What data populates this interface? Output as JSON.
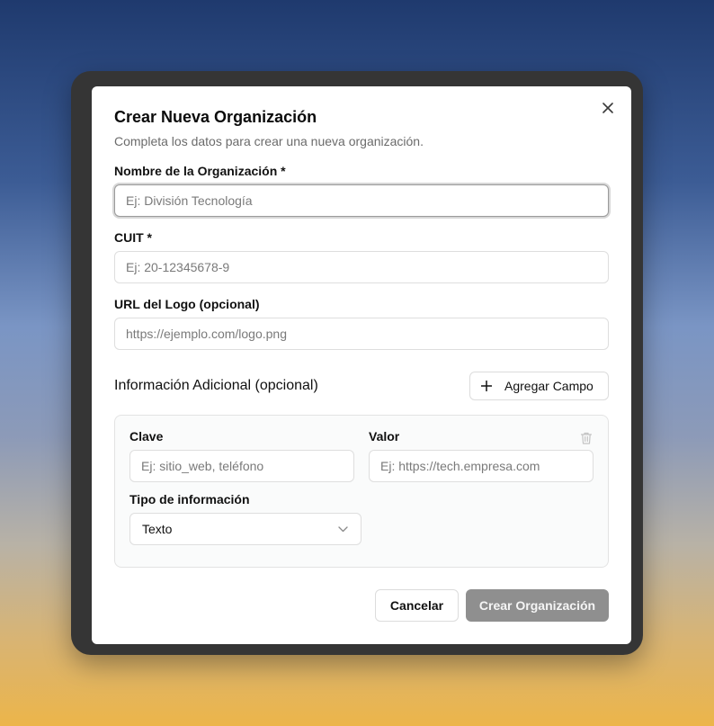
{
  "dialog": {
    "title": "Crear Nueva Organización",
    "subtitle": "Completa los datos para crear una nueva organización."
  },
  "fields": {
    "name": {
      "label": "Nombre de la Organización *",
      "placeholder": "Ej: División Tecnología",
      "value": ""
    },
    "cuit": {
      "label": "CUIT *",
      "placeholder": "Ej: 20-12345678-9",
      "value": ""
    },
    "logo": {
      "label": "URL del Logo (opcional)",
      "placeholder": "https://ejemplo.com/logo.png",
      "value": ""
    }
  },
  "additional": {
    "title": "Información Adicional (opcional)",
    "add_button_label": "Agregar Campo",
    "entries": [
      {
        "key_label": "Clave",
        "key_placeholder": "Ej: sitio_web, teléfono",
        "value_label": "Valor",
        "value_placeholder": "Ej: https://tech.empresa.com",
        "type_label": "Tipo de información",
        "type_selected": "Texto"
      }
    ]
  },
  "footer": {
    "cancel_label": "Cancelar",
    "create_label": "Crear Organización"
  },
  "icons": {
    "close": "close-icon",
    "add": "plus-icon",
    "delete": "trash-icon",
    "select": "chevron-down-icon"
  }
}
